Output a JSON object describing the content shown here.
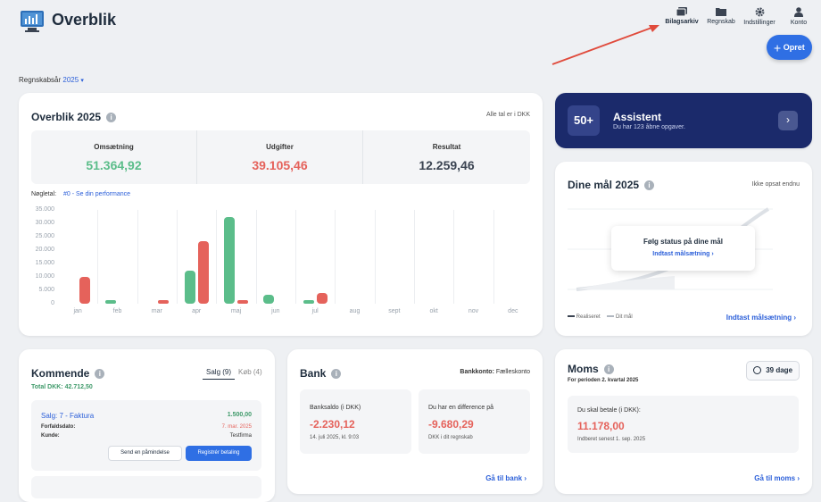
{
  "header": {
    "title": "Overblik"
  },
  "nav": {
    "archive": "Bilagsarkiv",
    "accounting": "Regnskab",
    "settings": "Indstillinger",
    "account": "Konto",
    "create": "Opret"
  },
  "year_selector": {
    "label": "Regnskabsår",
    "value": "2025"
  },
  "overview": {
    "title": "Overblik 2025",
    "note": "Alle tal er i DKK",
    "revenue_label": "Omsætning",
    "revenue": "51.364,92",
    "expenses_label": "Udgifter",
    "expenses": "39.105,46",
    "result_label": "Resultat",
    "result": "12.259,46",
    "keynumber_label": "Nøgletal:",
    "keynumber_link": "#0 - Se din performance"
  },
  "chart_data": {
    "type": "bar",
    "categories": [
      "jan",
      "feb",
      "mar",
      "apr",
      "maj",
      "jun",
      "jul",
      "aug",
      "sept",
      "okt",
      "nov",
      "dec"
    ],
    "yticks": [
      "35.000",
      "30.000",
      "25.000",
      "20.000",
      "15.000",
      "10.000",
      "5.000",
      "0"
    ],
    "ylim": [
      0,
      35000
    ],
    "series": [
      {
        "color": "#5bbd8a",
        "values": [
          0,
          1500,
          0,
          12500,
          32500,
          3500,
          1500,
          0,
          0,
          0,
          0,
          0
        ]
      },
      {
        "color": "#e5625b",
        "values": [
          10000,
          0,
          1500,
          23500,
          1500,
          0,
          4000,
          0,
          0,
          0,
          0,
          0
        ]
      }
    ]
  },
  "assistant": {
    "badge": "50+",
    "title": "Assistent",
    "subtitle": "Du har 123 åbne opgaver."
  },
  "goals": {
    "title": "Dine mål 2025",
    "status": "Ikke opsat endnu",
    "overlay_title": "Følg status på dine mål",
    "overlay_link": "Indtast målsætning",
    "legend_realized": "Realiseret",
    "legend_goal": "Dit mål",
    "footer_link": "Indtast målsætning"
  },
  "upcoming": {
    "title": "Kommende",
    "tab_sales": "Salg (9)",
    "tab_purchase": "Køb (4)",
    "total_label": "Total DKK:",
    "total": "42.712,50",
    "item_title": "Salg: 7 - Faktura",
    "item_amount": "1.500,00",
    "due_label": "Forfaldsdato:",
    "due_date": "7. mar. 2025",
    "customer_label": "Kunde:",
    "customer": "Testfirma",
    "reminder_btn": "Send en påmindelse",
    "register_btn": "Registrér betaling"
  },
  "bank": {
    "title": "Bank",
    "account_label": "Bankkonto:",
    "account": "Fælleskonto",
    "balance_label": "Banksaldo (i DKK)",
    "balance": "-2.230,12",
    "balance_date": "14. juli 2025, kl. 9:03",
    "diff_label": "Du har en difference på",
    "diff": "-9.680,29",
    "diff_note": "DKK i dit regnskab",
    "link": "Gå til bank"
  },
  "vat": {
    "title": "Moms",
    "period": "For perioden 2. kvartal 2025",
    "days": "39 dage",
    "pay_label": "Du skal betale (i DKK):",
    "amount": "11.178,00",
    "deadline": "Indberet senest 1. sep. 2025",
    "link": "Gå til moms"
  },
  "colors": {
    "green": "#5bbd8a",
    "red": "#e5625b",
    "navy": "#1b2a6b",
    "link": "#2b5fd9"
  }
}
